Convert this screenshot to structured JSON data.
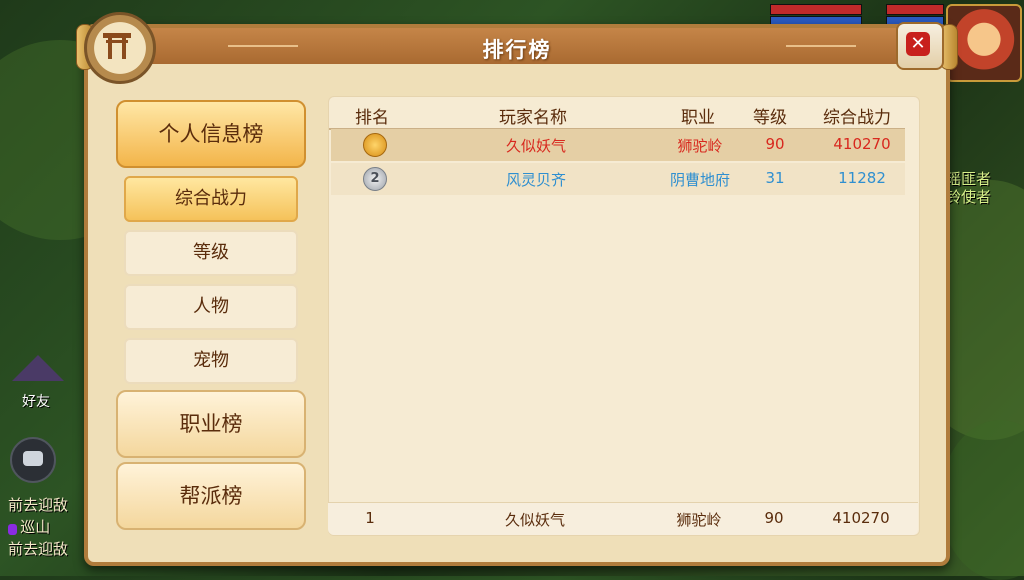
{
  "hud": {
    "friend_label": "好友",
    "chat_lines": [
      "前去迎敌",
      "巡山",
      "前去迎敌"
    ],
    "patrol_tag": "",
    "npc_names": [
      "瑶匪者",
      "铃使者"
    ]
  },
  "panel": {
    "title": "排行榜"
  },
  "sidebar": {
    "main_tabs": [
      {
        "label": "个人信息榜",
        "active": true
      },
      {
        "label": "职业榜",
        "active": false
      },
      {
        "label": "帮派榜",
        "active": false
      }
    ],
    "sub_tabs": [
      {
        "label": "综合战力",
        "active": true
      },
      {
        "label": "等级",
        "active": false
      },
      {
        "label": "人物",
        "active": false
      },
      {
        "label": "宠物",
        "active": false
      }
    ]
  },
  "table": {
    "headers": [
      "排名",
      "玩家名称",
      "职业",
      "等级",
      "综合战力"
    ],
    "rows": [
      {
        "rank": "",
        "medal": "gold",
        "name": "久似妖气",
        "class": "狮驼岭",
        "level": "90",
        "power": "410270",
        "color": "#d8281e"
      },
      {
        "rank": "2",
        "medal": "silver",
        "name": "风灵贝齐",
        "class": "阴曹地府",
        "level": "31",
        "power": "11282",
        "color": "#2f8fd0"
      }
    ],
    "my_rank": {
      "rank": "1",
      "name": "久似妖气",
      "class": "狮驼岭",
      "level": "90",
      "power": "410270"
    }
  }
}
